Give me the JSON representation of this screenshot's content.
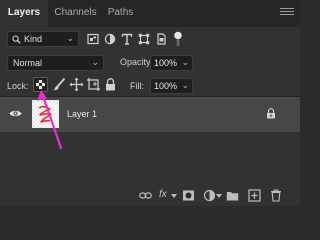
{
  "tabs": [
    "Layers",
    "Channels",
    "Paths"
  ],
  "filter": {
    "kind_label": "Kind",
    "icons": [
      "pixel-filter-icon",
      "adjustment-filter-icon",
      "type-filter-icon",
      "shape-filter-icon",
      "smart-object-filter-icon",
      "filter-toggle-icon"
    ]
  },
  "blend": {
    "mode": "Normal"
  },
  "opacity": {
    "label": "Opacity:",
    "value": "100%"
  },
  "lock": {
    "label": "Lock:",
    "icons": [
      "lock-transparent-pixels-icon",
      "lock-image-pixels-icon",
      "lock-position-icon",
      "lock-artboard-icon",
      "lock-all-icon"
    ]
  },
  "fill": {
    "label": "Fill:",
    "value": "100%"
  },
  "layer": {
    "name": "Layer 1",
    "visible": true,
    "locked": true
  },
  "bottom": {
    "fx_label": "fx",
    "icons": [
      "link-layers-icon",
      "add-layer-style-icon",
      "add-mask-icon",
      "new-adjustment-layer-icon",
      "new-group-icon",
      "new-layer-icon",
      "delete-layer-icon"
    ]
  },
  "colors": {
    "panel": "#323232",
    "tab_bar": "#262626",
    "selected_row": "#474747",
    "annotation_arrow": "#e233c5",
    "thumb_stroke": "#e2302f"
  }
}
